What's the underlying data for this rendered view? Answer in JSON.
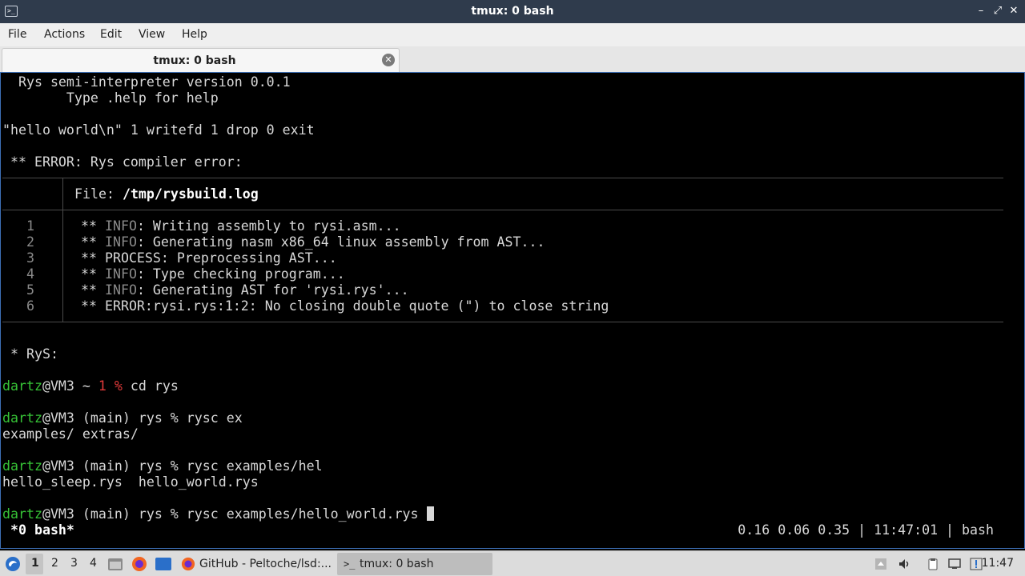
{
  "window": {
    "title": "tmux: 0 bash",
    "app_icon_glyph": ">_"
  },
  "menu": {
    "items": [
      "File",
      "Actions",
      "Edit",
      "View",
      "Help"
    ]
  },
  "tab": {
    "label": "tmux: 0 bash"
  },
  "terminal": {
    "banner_1": "  Rys semi-interpreter version 0.0.1",
    "banner_2": "        Type .help for help",
    "input_line": "\"hello world\\n\" 1 writefd 1 drop 0 exit",
    "error_line": " ** ERROR: Rys compiler error:",
    "file_label": "File: ",
    "file_path": "/tmp/rysbuild.log",
    "log_lines": [
      {
        "num": "1",
        "prefix": " ** ",
        "level": "INFO",
        "text": ": Writing assembly to rysi.asm..."
      },
      {
        "num": "2",
        "prefix": " ** ",
        "level": "INFO",
        "text": ": Generating nasm x86_64 linux assembly from AST..."
      },
      {
        "num": "3",
        "prefix": " ** ",
        "level": "",
        "text": "PROCESS: Preprocessing AST..."
      },
      {
        "num": "4",
        "prefix": " ** ",
        "level": "INFO",
        "text": ": Type checking program..."
      },
      {
        "num": "5",
        "prefix": " ** ",
        "level": "INFO",
        "text": ": Generating AST for 'rysi.rys'..."
      },
      {
        "num": "6",
        "prefix": " ** ",
        "level": "",
        "text": "ERROR:rysi.rys:1:2: No closing double quote (\") to close string"
      }
    ],
    "rys_marker": " * RyS:",
    "prompt_user": "dartz",
    "prompt_host_home": "@VM3 ~ ",
    "prompt_status_num": "1 %",
    "cmd_1": " cd rys",
    "prompt_host_repo": "@VM3 (main) rys % ",
    "cmd_2": "rysc ex",
    "completion_1": "examples/ extras/",
    "cmd_3": "rysc examples/hel",
    "completion_2": "hello_sleep.rys  hello_world.rys",
    "cmd_4": "rysc examples/hello_world.rys ",
    "status_left": " *0 bash*",
    "status_right": "0.16 0.06 0.35 | 11:47:01 | bash"
  },
  "taskbar": {
    "workspaces": [
      "1",
      "2",
      "3",
      "4"
    ],
    "active_workspace": "1",
    "tasks": [
      {
        "label": "GitHub - Peltoche/lsd:...",
        "icon": "firefox-icon"
      },
      {
        "label": "tmux: 0 bash",
        "icon": "terminal-icon"
      }
    ],
    "clock": "11:47"
  },
  "colors": {
    "titlebar": "#2f3b4c",
    "prompt_user": "#36c236",
    "prompt_status": "#e23a3a",
    "terminal_bg": "#000000"
  }
}
